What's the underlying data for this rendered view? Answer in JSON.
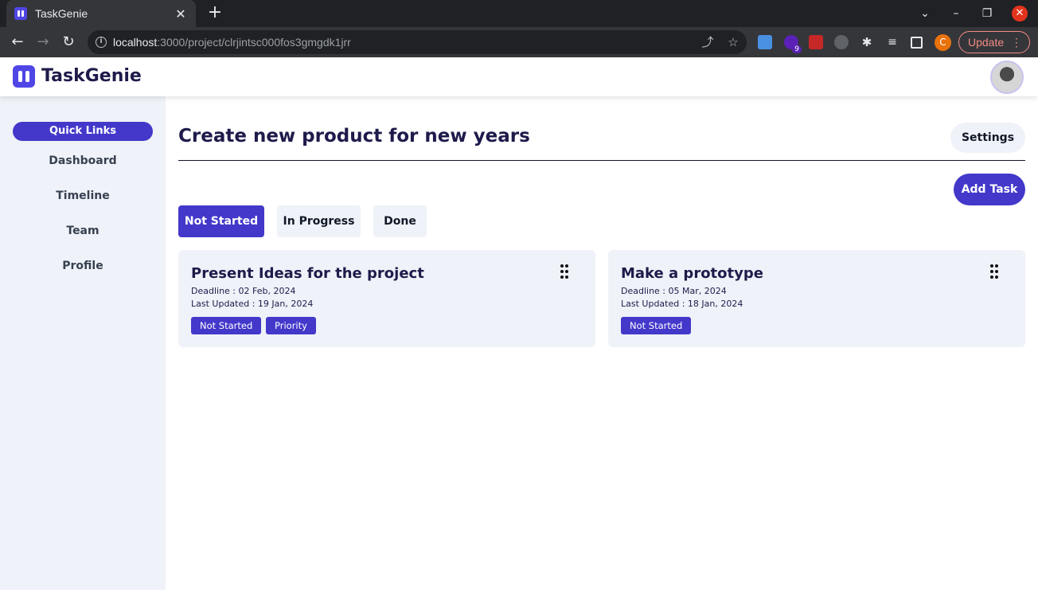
{
  "browser": {
    "tab_title": "TaskGenie",
    "url_host": "localhost",
    "url_rest": ":3000/project/clrjintsc000fos3gmgdk1jrr",
    "profile_initial": "C",
    "update_label": "Update",
    "extension_badge": "9"
  },
  "app": {
    "name": "TaskGenie"
  },
  "sidebar": {
    "quick_links": "Quick Links",
    "items": [
      {
        "label": "Dashboard"
      },
      {
        "label": "Timeline"
      },
      {
        "label": "Team"
      },
      {
        "label": "Profile"
      }
    ]
  },
  "main": {
    "title": "Create new product for new years",
    "settings_label": "Settings",
    "add_task_label": "Add Task",
    "tabs": [
      {
        "label": "Not Started",
        "active": true
      },
      {
        "label": "In Progress",
        "active": false
      },
      {
        "label": "Done",
        "active": false
      }
    ],
    "cards": [
      {
        "title": "Present Ideas for the project",
        "deadline": "Deadline : 02 Feb, 2024",
        "last_updated": "Last Updated : 19 Jan, 2024",
        "badges": [
          "Not Started",
          "Priority"
        ]
      },
      {
        "title": "Make a prototype",
        "deadline": "Deadline : 05 Mar, 2024",
        "last_updated": "Last Updated : 18 Jan, 2024",
        "badges": [
          "Not Started"
        ]
      }
    ]
  },
  "colors": {
    "accent": "#4338ca",
    "title": "#1e1b4b",
    "sidebar_bg": "#eff2f8"
  }
}
